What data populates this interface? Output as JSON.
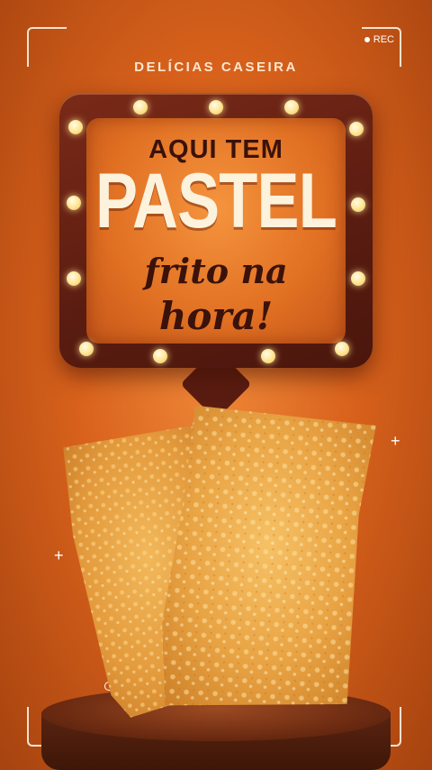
{
  "screen": {
    "rec_label": "REC",
    "brand": "DELÍCIAS CASEIRA",
    "headline_top": "AQUI TEM",
    "headline_main": "PASTEL",
    "headline_script_1": "frito na",
    "headline_script_2": "hora!"
  },
  "colors": {
    "background": "#d9621c",
    "sign_frame": "#5a1c10",
    "sign_panel": "#e06f22",
    "bulb": "#ffe9a0",
    "headline_cream": "#fdf2dc",
    "headline_dark": "#3a120a"
  },
  "icons": [
    "rec-dot-icon",
    "sparkle-icon",
    "ring-icon",
    "marquee-bulb-icon"
  ]
}
